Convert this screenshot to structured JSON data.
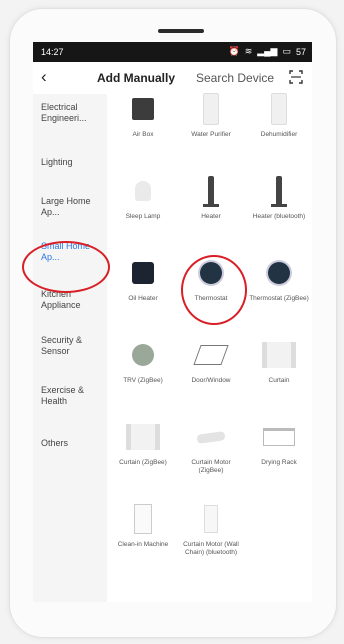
{
  "status_bar": {
    "time": "14:27",
    "battery": "57"
  },
  "header": {
    "back_icon": "back-arrow",
    "tabs": [
      {
        "label": "Add Manually",
        "active": true
      },
      {
        "label": "Search Device",
        "active": false
      }
    ],
    "scan_icon": "scan-icon"
  },
  "sidebar": {
    "items": [
      {
        "label": "Electrical Engineeri..."
      },
      {
        "label": "Lighting"
      },
      {
        "label": "Large Home Ap..."
      },
      {
        "label": "Small Home Ap...",
        "active": true
      },
      {
        "label": "Kitchen Appliance"
      },
      {
        "label": "Security & Sensor"
      },
      {
        "label": "Exercise & Health"
      },
      {
        "label": "Others"
      }
    ]
  },
  "devices": [
    {
      "label": "Air Box"
    },
    {
      "label": "Water Purifier"
    },
    {
      "label": "Dehumidifier"
    },
    {
      "label": "Sleep Lamp"
    },
    {
      "label": "Heater"
    },
    {
      "label": "Heater (bluetooth)"
    },
    {
      "label": "Oil Heater"
    },
    {
      "label": "Thermostat"
    },
    {
      "label": "Thermostat (ZigBee)"
    },
    {
      "label": "TRV (ZigBee)"
    },
    {
      "label": "Door/Window"
    },
    {
      "label": "Curtain"
    },
    {
      "label": "Curtain (ZigBee)"
    },
    {
      "label": "Curtain Motor (ZigBee)"
    },
    {
      "label": "Drying Rack"
    },
    {
      "label": "Clean-in Machine"
    },
    {
      "label": "Curtain Motor (Wall Chain) (bluetooth)"
    }
  ],
  "colors": {
    "accent": "#2b78e4",
    "highlight": "#d81f26"
  }
}
